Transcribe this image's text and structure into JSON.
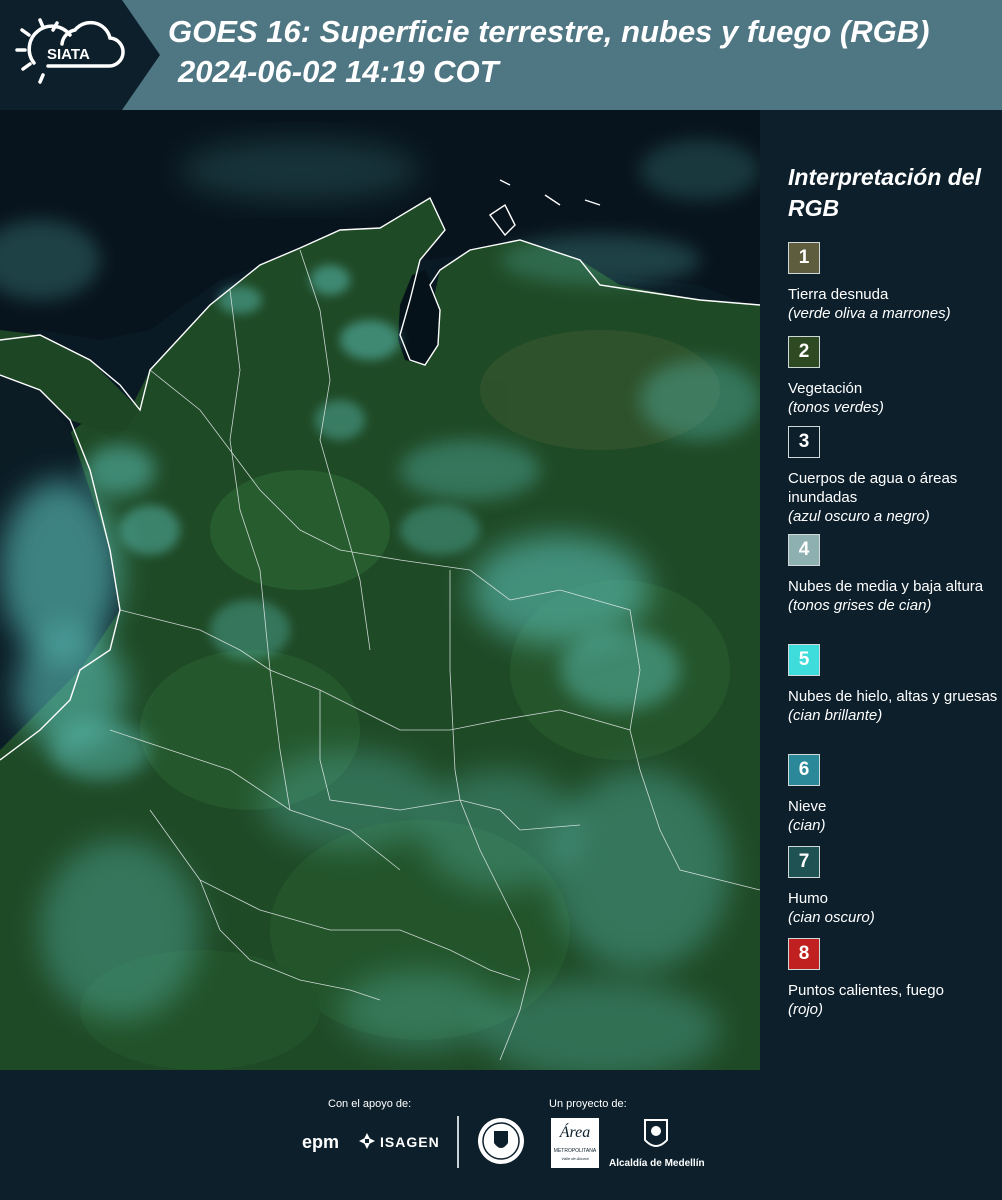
{
  "header": {
    "logo_text": "SIATA",
    "title_line1": "GOES 16: Superficie terrestre, nubes y fuego (RGB)",
    "title_line2": "2024-06-02 14:19 COT"
  },
  "legend": {
    "title": "Interpretación del RGB",
    "items": [
      {
        "number": "1",
        "color": "#5e5e3e",
        "label": "Tierra desnuda",
        "sub": "(verde oliva a marrones)"
      },
      {
        "number": "2",
        "color": "#2e4a22",
        "label": "Vegetación",
        "sub": "(tonos verdes)"
      },
      {
        "number": "3",
        "color": "#0c1f2b",
        "label": "Cuerpos de agua o áreas inundadas",
        "sub": "(azul oscuro a negro)"
      },
      {
        "number": "4",
        "color": "#8fb0b0",
        "label": "Nubes de media y baja altura",
        "sub": "(tonos grises de cian)"
      },
      {
        "number": "5",
        "color": "#3fdcdc",
        "label": "Nubes de hielo, altas y gruesas",
        "sub": "(cian brillante)"
      },
      {
        "number": "6",
        "color": "#2a8898",
        "label": "Nieve",
        "sub": "(cian)"
      },
      {
        "number": "7",
        "color": "#1f5252",
        "label": "Humo",
        "sub": "(cian oscuro)"
      },
      {
        "number": "8",
        "color": "#c02020",
        "label": "Puntos calientes, fuego",
        "sub": "(rojo)"
      }
    ]
  },
  "footer": {
    "support_label": "Con el apoyo de:",
    "project_label": "Un proyecto de:",
    "sponsor1": "epm",
    "sponsor2": "ISAGEN",
    "partner1_line1": "Área",
    "partner1_line2": "METROPOLITANA",
    "partner1_line3": "Valle de Aburrá",
    "partner2": "Alcaldía de Medellín"
  },
  "colors": {
    "header_bg": "#4f7683",
    "panel_bg": "#0c1f2b",
    "ocean": "#0a1a24",
    "land": "#2a5a2e",
    "cloud": "#5fc8c0"
  }
}
